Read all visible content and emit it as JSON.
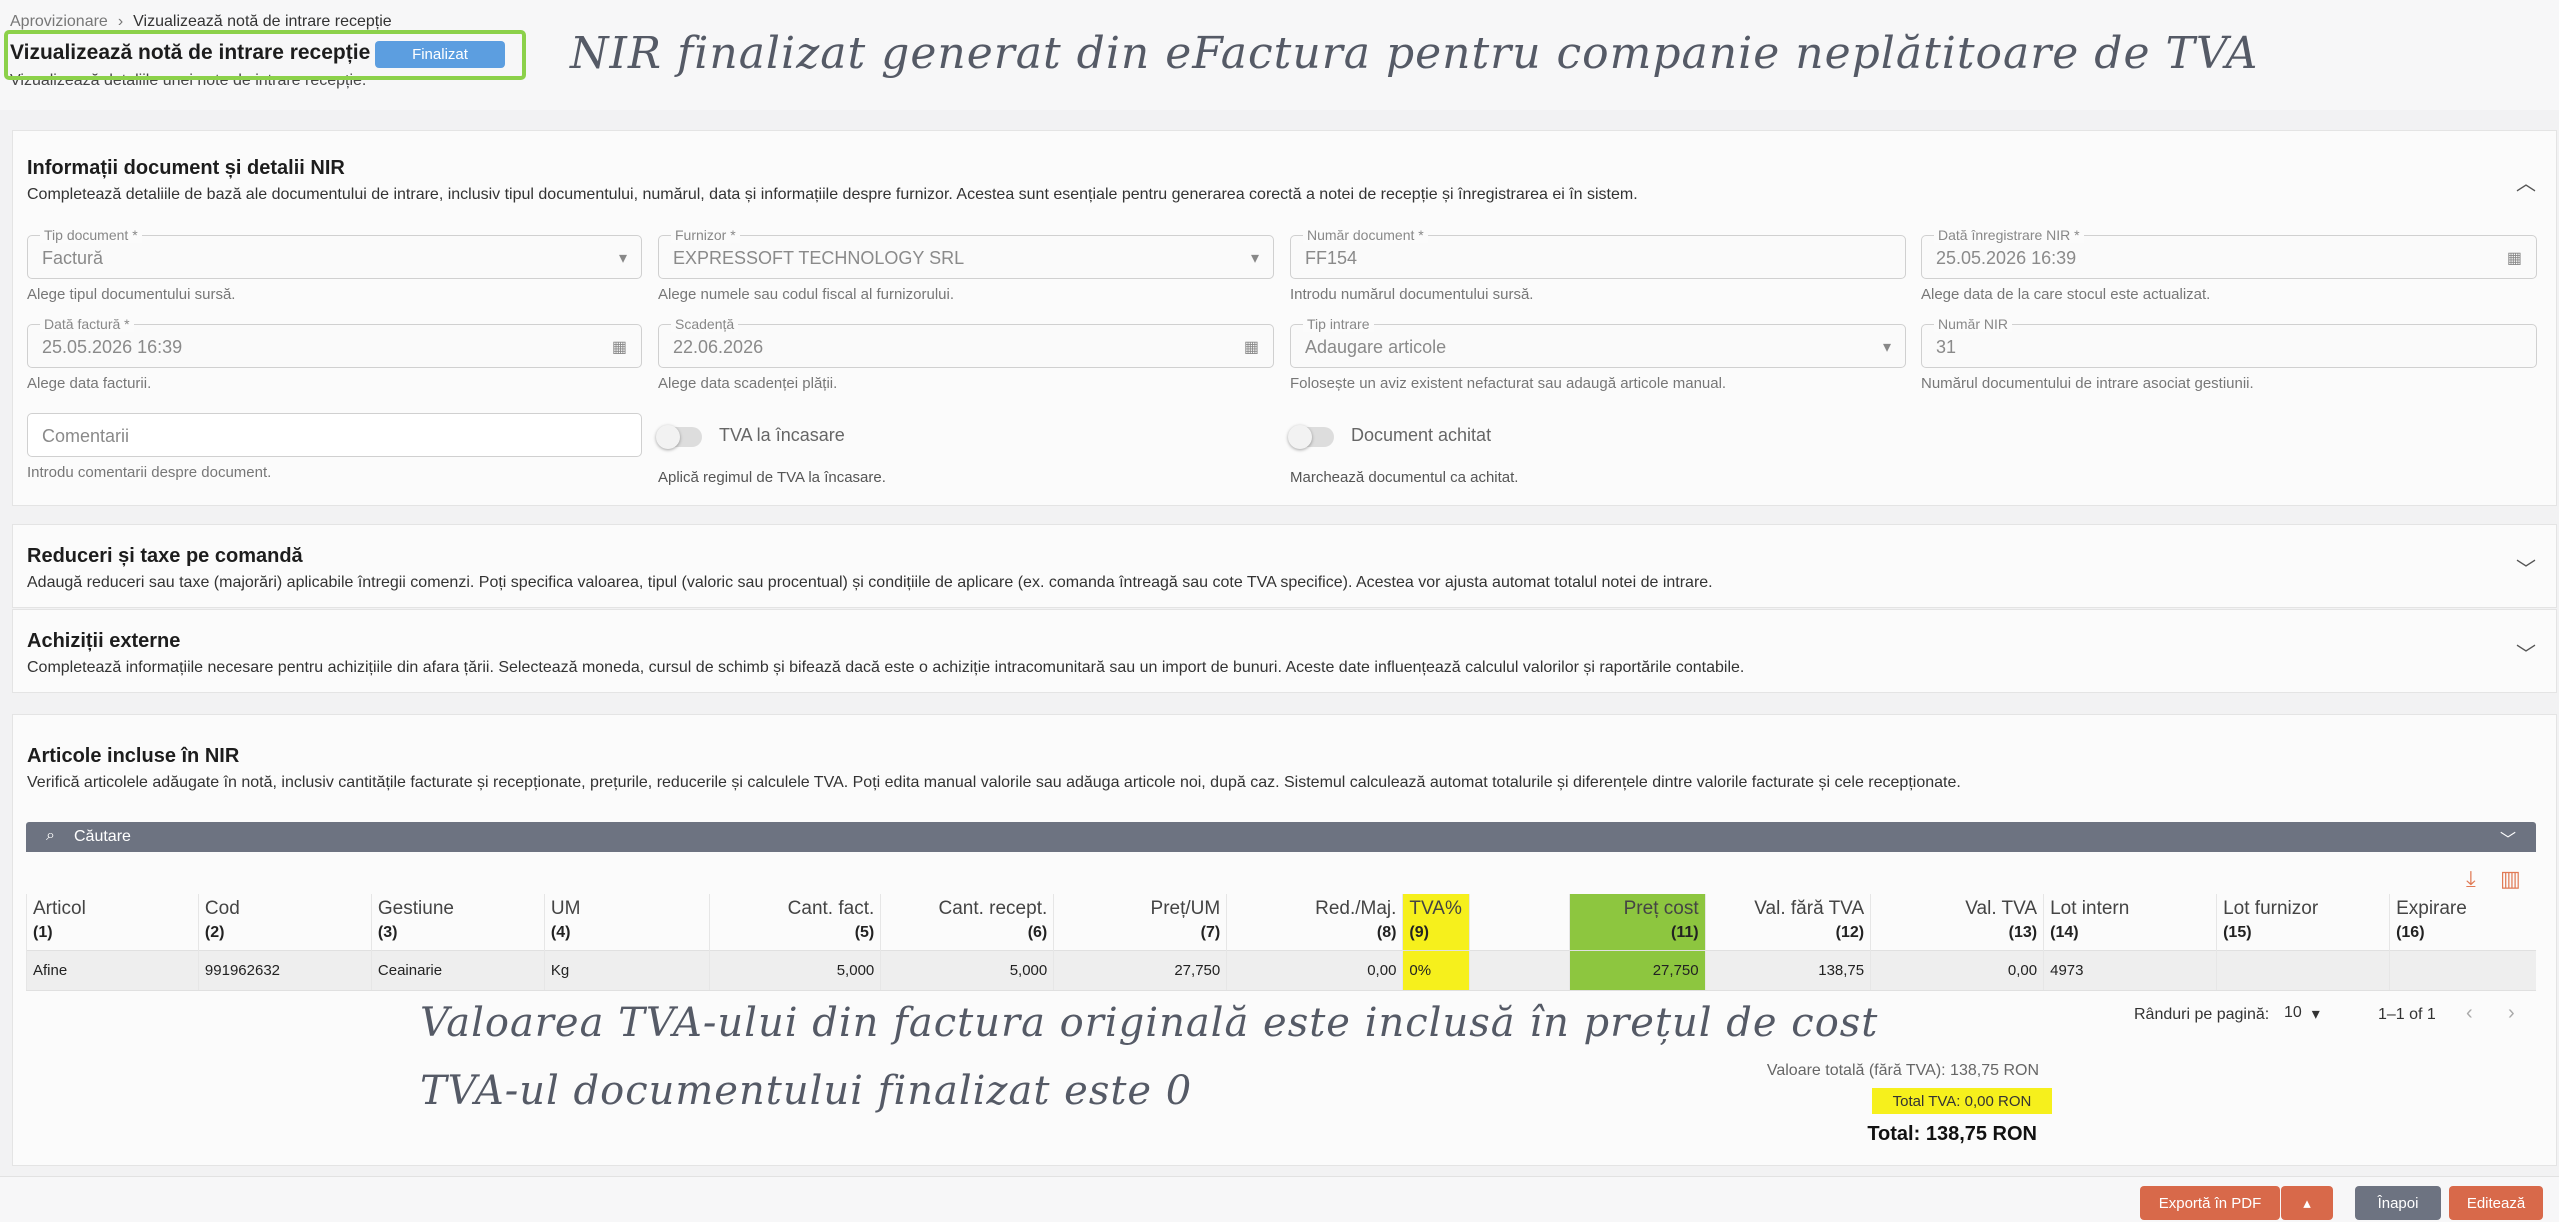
{
  "breadcrumb": {
    "parent": "Aprovizionare",
    "separator": "›",
    "current": "Vizualizează notă de intrare recepție"
  },
  "header": {
    "title": "Vizualizează notă de intrare recepție",
    "status": "Finalizat",
    "subtitle": "Vizualizează detaliile unei note de intrare recepție."
  },
  "annotations": {
    "top": "NIR finalizat generat din eFactura pentru companie neplătitoare de TVA",
    "cost": "Valoarea TVA-ului din factura originală este inclusă în prețul de cost",
    "tva": "TVA-ul documentului finalizat este 0"
  },
  "doc_section": {
    "title": "Informații document și detalii NIR",
    "desc": "Completează detaliile de bază ale documentului de intrare, inclusiv tipul documentului, numărul, data și informațiile despre furnizor. Acestea sunt esențiale pentru generarea corectă a notei de recepție și înregistrarea ei în sistem.",
    "fields": {
      "tip_doc": {
        "label": "Tip document *",
        "value": "Factură",
        "helper": "Alege tipul documentului sursă."
      },
      "furnizor": {
        "label": "Furnizor *",
        "value": "EXPRESSOFT TECHNOLOGY SRL",
        "helper": "Alege numele sau codul fiscal al furnizorului."
      },
      "numar_doc": {
        "label": "Număr document *",
        "value": "FF154",
        "helper": "Introdu numărul documentului sursă."
      },
      "data_inreg": {
        "label": "Dată înregistrare NIR *",
        "value": "25.05.2026 16:39",
        "helper": "Alege data de la care stocul este actualizat."
      },
      "data_factura": {
        "label": "Dată factură *",
        "value": "25.05.2026 16:39",
        "helper": "Alege data facturii."
      },
      "scadenta": {
        "label": "Scadență",
        "value": "22.06.2026",
        "helper": "Alege data scadenței plății."
      },
      "tip_intrare": {
        "label": "Tip intrare",
        "value": "Adaugare articole",
        "helper": "Folosește un aviz existent nefacturat sau adaugă articole manual."
      },
      "numar_nir": {
        "label": "Număr NIR",
        "value": "31",
        "helper": "Numărul documentului de intrare asociat gestiunii."
      },
      "comentarii": {
        "placeholder": "Comentarii",
        "helper": "Introdu comentarii despre document."
      }
    },
    "toggles": {
      "tva_incasare": {
        "label": "TVA la încasare",
        "helper": "Aplică regimul de TVA la încasare."
      },
      "achitat": {
        "label": "Document achitat",
        "helper": "Marchează documentul ca achitat."
      }
    }
  },
  "discount_section": {
    "title": "Reduceri și taxe pe comandă",
    "desc": "Adaugă reduceri sau taxe (majorări) aplicabile întregii comenzi. Poți specifica valoarea, tipul (valoric sau procentual) și condițiile de aplicare (ex. comanda întreagă sau cote TVA specifice). Acestea vor ajusta automat totalul notei de intrare."
  },
  "external_section": {
    "title": "Achiziții externe",
    "desc": "Completează informațiile necesare pentru achizițiile din afara țării. Selectează moneda, cursul de schimb și bifează dacă este o achiziție intracomunitară sau un import de bunuri. Aceste date influențează calculul valorilor și raportările contabile."
  },
  "articles_section": {
    "title": "Articole incluse în NIR",
    "desc": "Verifică articolele adăugate în notă, inclusiv cantitățile facturate și recepționate, prețurile, reducerile și calculele TVA. Poți edita manual valorile sau adăuga articole noi, după caz. Sistemul calculează automat totalurile și diferențele dintre valorile facturate și cele recepționate.",
    "search_label": "Căutare",
    "columns": [
      {
        "label": "Articol",
        "num": "(1)"
      },
      {
        "label": "Cod",
        "num": "(2)"
      },
      {
        "label": "Gestiune",
        "num": "(3)"
      },
      {
        "label": "UM",
        "num": "(4)"
      },
      {
        "label": "Cant. fact.",
        "num": "(5)"
      },
      {
        "label": "Cant. recept.",
        "num": "(6)"
      },
      {
        "label": "Preț/UM",
        "num": "(7)"
      },
      {
        "label": "Red./Maj.",
        "num": "(8)"
      },
      {
        "label": "TVA%",
        "num": "(9)"
      },
      {
        "label": "",
        "num": ""
      },
      {
        "label": "Preț cost",
        "num": "(11)"
      },
      {
        "label": "Val. fără TVA",
        "num": "(12)"
      },
      {
        "label": "Val. TVA",
        "num": "(13)"
      },
      {
        "label": "Lot intern",
        "num": "(14)"
      },
      {
        "label": "Lot furnizor",
        "num": "(15)"
      },
      {
        "label": "Expirare",
        "num": "(16)"
      }
    ],
    "rows": [
      [
        "Afine",
        "991962632",
        "Ceainarie",
        "Kg",
        "5,000",
        "5,000",
        "27,750",
        "0,00",
        "0%",
        "",
        "27,750",
        "138,75",
        "0,00",
        "4973",
        "",
        ""
      ]
    ],
    "pagination": {
      "rows_per_page_label": "Rânduri pe pagină:",
      "rows_per_page": "10",
      "range": "1–1 of 1"
    },
    "totals": {
      "net": "Valoare totală (fără TVA): 138,75 RON",
      "tva": "Total TVA: 0,00 RON",
      "grand": "Total: 138,75 RON"
    }
  },
  "footer": {
    "export": "Exportă în PDF",
    "back": "Înapoi",
    "edit": "Editează"
  },
  "colors": {
    "accent": "#5c9ee0",
    "highlight_yellow": "#f6f01c",
    "highlight_green": "#8dc63f",
    "action": "#d8694a",
    "neutral_button": "#6d7381"
  }
}
